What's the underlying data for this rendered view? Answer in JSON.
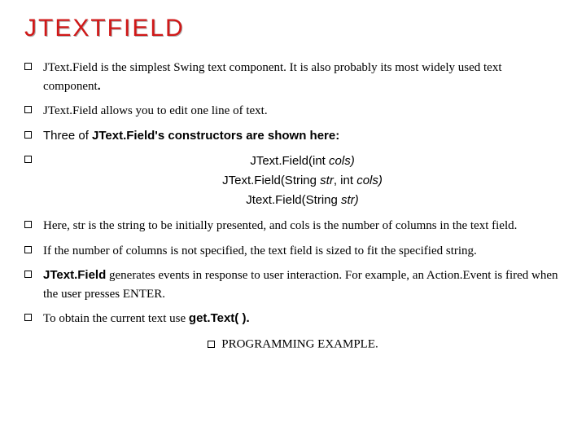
{
  "title": "JTEXTFIELD",
  "bullets": {
    "b1a": "JText.Field is the simplest Swing text component. It is also probably its most widely used text component",
    "b1b": ".",
    "b2": "JText.Field allows you to edit one line of text.",
    "b3a": "Three of ",
    "b3b": "JText.Field's constructors are shown here:",
    "c1a": "JText.Field(int ",
    "c1b": "cols)",
    "c2a": "JText.Field(String ",
    "c2b": "str",
    "c2c": ", int ",
    "c2d": "cols)",
    "c3a": "Jtext.Field(String ",
    "c3b": "str)",
    "b5": "Here, str is the string to be initially presented, and cols is the number of columns in the text field.",
    "b6": "If the number of columns is not specified, the text field is sized to fit the specified string.",
    "b7a": "JText.Field",
    "b7b": " generates events in response to user interaction. For example, an Action.Event is fired when the user presses ENTER.",
    "b8a": "To obtain the current text use ",
    "b8b": "get.Text( ).",
    "footer": "PROGRAMMING EXAMPLE."
  }
}
